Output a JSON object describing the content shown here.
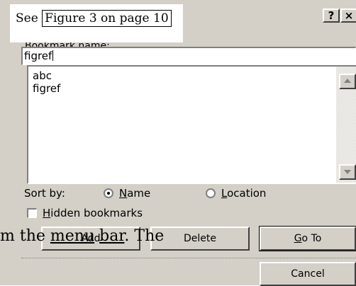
{
  "overlay_caption": {
    "prefix": "See ",
    "reference": "Figure 3 on page 10"
  },
  "dialog": {
    "title_buttons": {
      "help": "?",
      "close": "×"
    },
    "bookmark_name_label": "Bookmark name:",
    "bookmark_name_value": "figref",
    "bookmarks": [
      "abc",
      "figref"
    ],
    "sort_by_label": "Sort by:",
    "sort_options": {
      "name": {
        "accel": "N",
        "rest": "ame",
        "selected": true
      },
      "location": {
        "accel": "L",
        "rest": "ocation",
        "selected": false
      }
    },
    "hidden_bookmarks": {
      "accel": "H",
      "rest": "idden bookmarks",
      "checked": false
    },
    "buttons": {
      "add": "Add",
      "delete": "Delete",
      "goto_accel": "G",
      "goto_rest": "o To",
      "cancel": "Cancel"
    }
  },
  "overlay_body_text": {
    "lead": "m the ",
    "underlined": "menu",
    "middle": " ",
    "underlined2": "bar",
    "tail": ". The"
  }
}
